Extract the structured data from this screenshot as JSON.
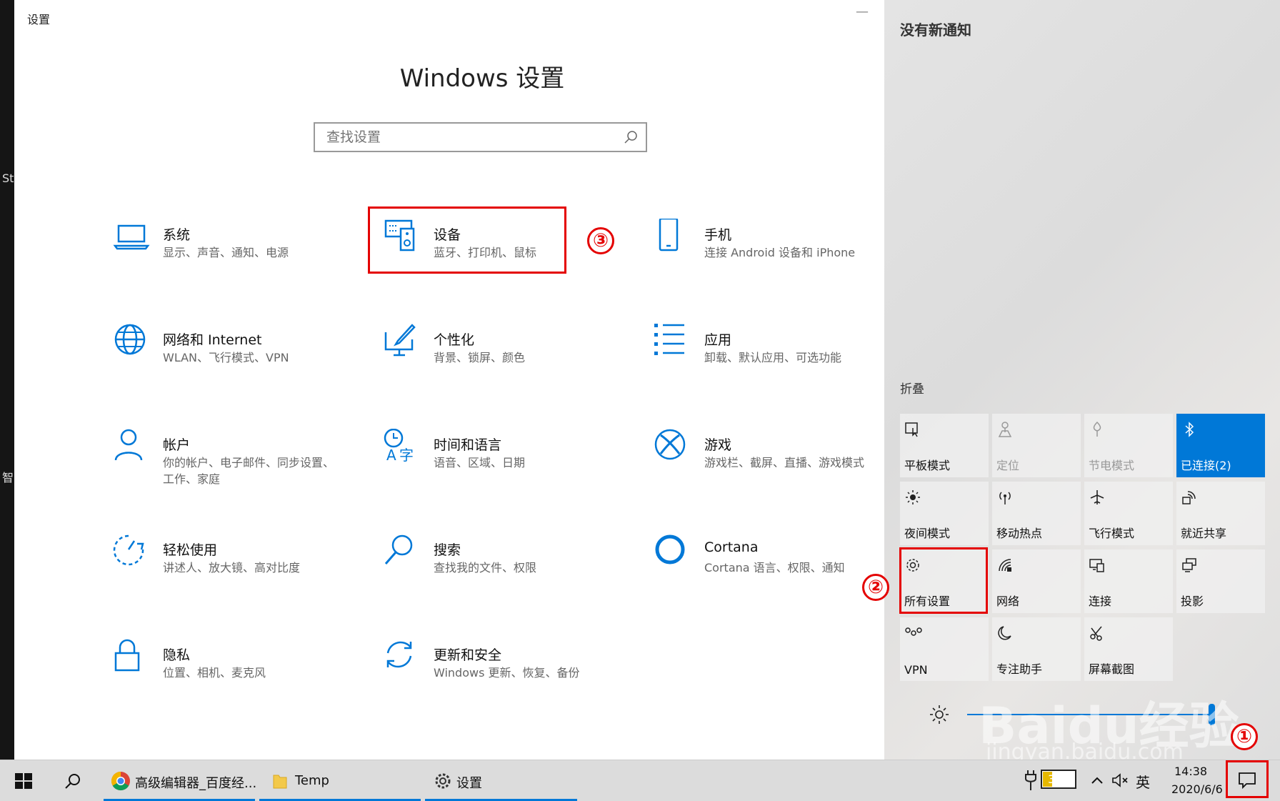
{
  "window": {
    "title": "设置",
    "minimize": "—"
  },
  "heading": "Windows 设置",
  "search": {
    "placeholder": "查找设置"
  },
  "tiles": [
    {
      "title": "系统",
      "subtitle": "显示、声音、通知、电源"
    },
    {
      "title": "设备",
      "subtitle": "蓝牙、打印机、鼠标"
    },
    {
      "title": "手机",
      "subtitle": "连接 Android 设备和 iPhone"
    },
    {
      "title": "网络和 Internet",
      "subtitle": "WLAN、飞行模式、VPN"
    },
    {
      "title": "个性化",
      "subtitle": "背景、锁屏、颜色"
    },
    {
      "title": "应用",
      "subtitle": "卸载、默认应用、可选功能"
    },
    {
      "title": "帐户",
      "subtitle": "你的帐户、电子邮件、同步设置、工作、家庭"
    },
    {
      "title": "时间和语言",
      "subtitle": "语音、区域、日期"
    },
    {
      "title": "游戏",
      "subtitle": "游戏栏、截屏、直播、游戏模式"
    },
    {
      "title": "轻松使用",
      "subtitle": "讲述人、放大镜、高对比度"
    },
    {
      "title": "搜索",
      "subtitle": "查找我的文件、权限"
    },
    {
      "title": "Cortana",
      "subtitle": "Cortana 语言、权限、通知"
    },
    {
      "title": "隐私",
      "subtitle": "位置、相机、麦克风"
    },
    {
      "title": "更新和安全",
      "subtitle": "Windows 更新、恢复、备份"
    }
  ],
  "desktop_text": [
    "St",
    "智"
  ],
  "annotations": {
    "one": "①",
    "two": "②",
    "three": "③"
  },
  "action_center": {
    "header": "没有新通知",
    "collapse": "折叠",
    "quick_actions": [
      {
        "label": "平板模式",
        "icon": "tablet-mode-icon",
        "state": "off"
      },
      {
        "label": "定位",
        "icon": "location-icon",
        "state": "disabled"
      },
      {
        "label": "节电模式",
        "icon": "battery-saver-icon",
        "state": "disabled"
      },
      {
        "label": "已连接(2)",
        "icon": "bluetooth-icon",
        "state": "on"
      },
      {
        "label": "夜间模式",
        "icon": "night-light-icon",
        "state": "off"
      },
      {
        "label": "移动热点",
        "icon": "hotspot-icon",
        "state": "off"
      },
      {
        "label": "飞行模式",
        "icon": "airplane-icon",
        "state": "off"
      },
      {
        "label": "就近共享",
        "icon": "nearby-share-icon",
        "state": "off"
      },
      {
        "label": "所有设置",
        "icon": "settings-gear-icon",
        "state": "off"
      },
      {
        "label": "网络",
        "icon": "network-icon",
        "state": "off"
      },
      {
        "label": "连接",
        "icon": "connect-icon",
        "state": "off"
      },
      {
        "label": "投影",
        "icon": "project-icon",
        "state": "off"
      },
      {
        "label": "VPN",
        "icon": "vpn-icon",
        "state": "off"
      },
      {
        "label": "专注助手",
        "icon": "focus-assist-icon",
        "state": "off"
      },
      {
        "label": "屏幕截图",
        "icon": "screen-snip-icon",
        "state": "off"
      }
    ],
    "brightness": 1.0
  },
  "taskbar": {
    "apps": [
      {
        "label": "高级编辑器_百度经...",
        "icon": "chrome-icon"
      },
      {
        "label": "Temp",
        "icon": "folder-icon"
      },
      {
        "label": "设置",
        "icon": "gear-icon"
      }
    ],
    "battery": "30%",
    "ime": "英",
    "time": "14:38",
    "date": "2020/6/6"
  },
  "watermark": {
    "logo": "Baidu经验",
    "url": "jingyan.baidu.com"
  },
  "colors": {
    "accent": "#0078d7",
    "highlight": "#e40000"
  }
}
